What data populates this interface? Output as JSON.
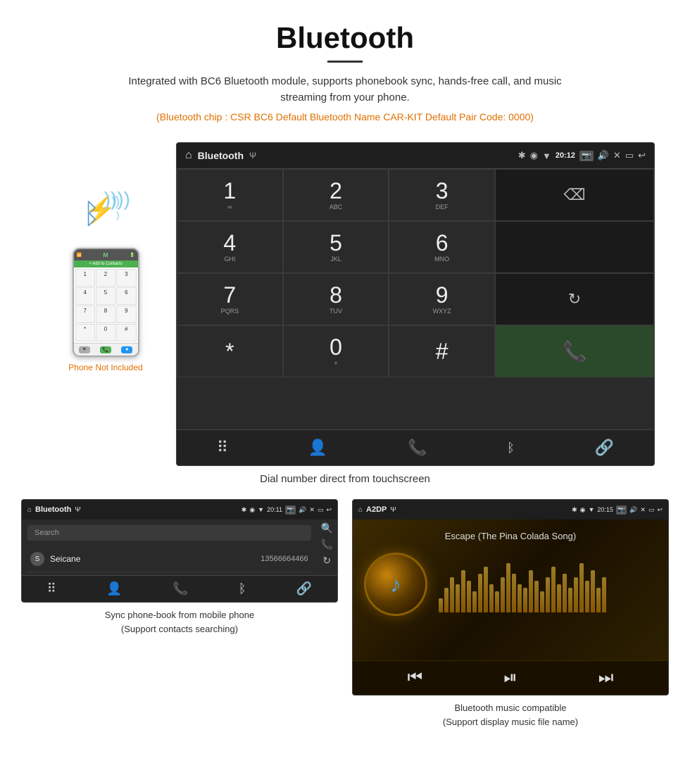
{
  "header": {
    "title": "Bluetooth",
    "description": "Integrated with BC6 Bluetooth module, supports phonebook sync, hands-free call, and music streaming from your phone.",
    "orange_info": "(Bluetooth chip : CSR BC6    Default Bluetooth Name CAR-KIT    Default Pair Code: 0000)"
  },
  "main_screen": {
    "status_bar": {
      "title": "Bluetooth",
      "usb_symbol": "⌀",
      "time": "20:12",
      "icons": [
        "✱",
        "◉",
        "▼",
        "📷",
        "🔊",
        "✕",
        "▭",
        "↩"
      ]
    },
    "keypad": [
      {
        "number": "1",
        "letters": "∞"
      },
      {
        "number": "2",
        "letters": "ABC"
      },
      {
        "number": "3",
        "letters": "DEF"
      },
      {
        "number": "4",
        "letters": "GHI"
      },
      {
        "number": "5",
        "letters": "JKL"
      },
      {
        "number": "6",
        "letters": "MNO"
      },
      {
        "number": "7",
        "letters": "PQRS"
      },
      {
        "number": "8",
        "letters": "TUV"
      },
      {
        "number": "9",
        "letters": "WXYZ"
      },
      {
        "number": "*",
        "letters": ""
      },
      {
        "number": "0",
        "letters": "+"
      },
      {
        "number": "#",
        "letters": ""
      }
    ],
    "caption": "Dial number direct from touchscreen"
  },
  "phone_illustration": {
    "not_included": "Phone Not Included",
    "contacts_label": "+ Add to Contacts"
  },
  "phonebook_screen": {
    "status_title": "Bluetooth",
    "time": "20:11",
    "search_placeholder": "Search",
    "contacts": [
      {
        "letter": "S",
        "name": "Seicane",
        "number": "13566664466"
      }
    ],
    "caption_line1": "Sync phone-book from mobile phone",
    "caption_line2": "(Support contacts searching)"
  },
  "music_screen": {
    "status_title": "A2DP",
    "time": "20:15",
    "song_title": "Escape (The Pina Colada Song)",
    "viz_bars": [
      20,
      35,
      50,
      40,
      60,
      45,
      30,
      55,
      65,
      40,
      30,
      50,
      70,
      55,
      40,
      35,
      60,
      45,
      30,
      50,
      65,
      40,
      55,
      35,
      50,
      70,
      45,
      60,
      35,
      50
    ],
    "caption_line1": "Bluetooth music compatible",
    "caption_line2": "(Support display music file name)"
  },
  "toolbar": {
    "icons": [
      "grid",
      "person",
      "phone",
      "bluetooth",
      "link"
    ]
  }
}
